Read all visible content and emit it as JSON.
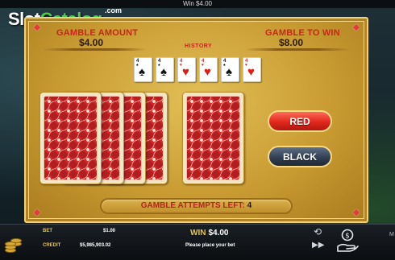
{
  "top_bar": {
    "win_text": "Win $4.00"
  },
  "logo": {
    "part1": "Slot",
    "part2": "Catalog",
    "suffix": ".com"
  },
  "gamble": {
    "amount_label": "GAMBLE AMOUNT",
    "amount_value": "$4.00",
    "to_win_label": "GAMBLE TO WIN",
    "to_win_value": "$8.00",
    "history_label": "HISTORY",
    "history_cards": [
      {
        "rank": "4",
        "suit": "spades",
        "glyph": "♠",
        "color": "black"
      },
      {
        "rank": "4",
        "suit": "spades",
        "glyph": "♠",
        "color": "black"
      },
      {
        "rank": "4",
        "suit": "hearts",
        "glyph": "♥",
        "color": "red"
      },
      {
        "rank": "4",
        "suit": "hearts",
        "glyph": "♥",
        "color": "red"
      },
      {
        "rank": "4",
        "suit": "spades",
        "glyph": "♠",
        "color": "black"
      },
      {
        "rank": "4",
        "suit": "hearts",
        "glyph": "♥",
        "color": "red"
      }
    ],
    "red_button": "RED",
    "black_button": "BLACK",
    "attempts_label": "GAMBLE ATTEMPTS LEFT:",
    "attempts_value": "4"
  },
  "bottom": {
    "bet_label": "BET",
    "bet_value": "$1.00",
    "credit_label": "CREDIT",
    "credit_value": "$5,985,903.02",
    "win_label": "WIN",
    "win_value": "$4.00",
    "message": "Please place your bet",
    "side_letter": "M"
  },
  "colors": {
    "panel_gold": "#c99c33",
    "label_red": "#c8251a",
    "button_red": "#e0281c",
    "button_black": "#334053",
    "card_back_red": "#d02a2a",
    "logo_green": "#4cc94a"
  }
}
